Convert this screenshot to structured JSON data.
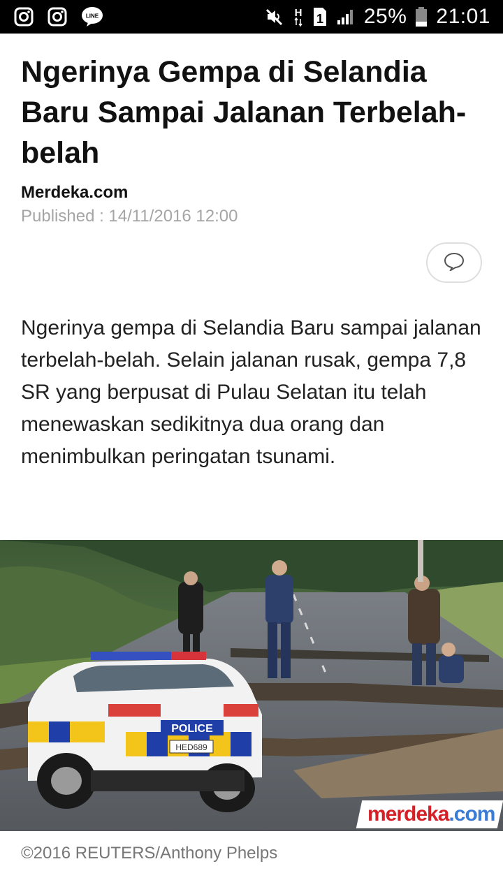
{
  "status_bar": {
    "battery": "25%",
    "time": "21:01",
    "sim_slot": "1",
    "network_h": "H",
    "icons": [
      "instagram-icon",
      "instagram-icon",
      "line-app-icon",
      "mute-icon",
      "network-h-icon",
      "sim-1-icon",
      "signal-icon",
      "battery-icon"
    ]
  },
  "article": {
    "title": "Ngerinya Gempa di Selandia Baru Sampai Jalanan Terbelah-belah",
    "source": "Merdeka.com",
    "published": "Published : 14/11/2016 12:00",
    "body": "Ngerinya gempa di Selandia Baru sampai jalanan terbelah-belah. Selain jalanan rusak, gempa 7,8 SR yang berpusat di Pulau Selatan itu telah menewaskan sedikitnya dua orang dan menimbulkan peringatan tsunami.",
    "comment_icon": "comment-bubble-icon"
  },
  "photo": {
    "police_label": "POLICE",
    "plate": "HED689",
    "watermark_a": "merdeka",
    "watermark_b": ".com",
    "caption": "©2016 REUTERS/Anthony Phelps"
  }
}
